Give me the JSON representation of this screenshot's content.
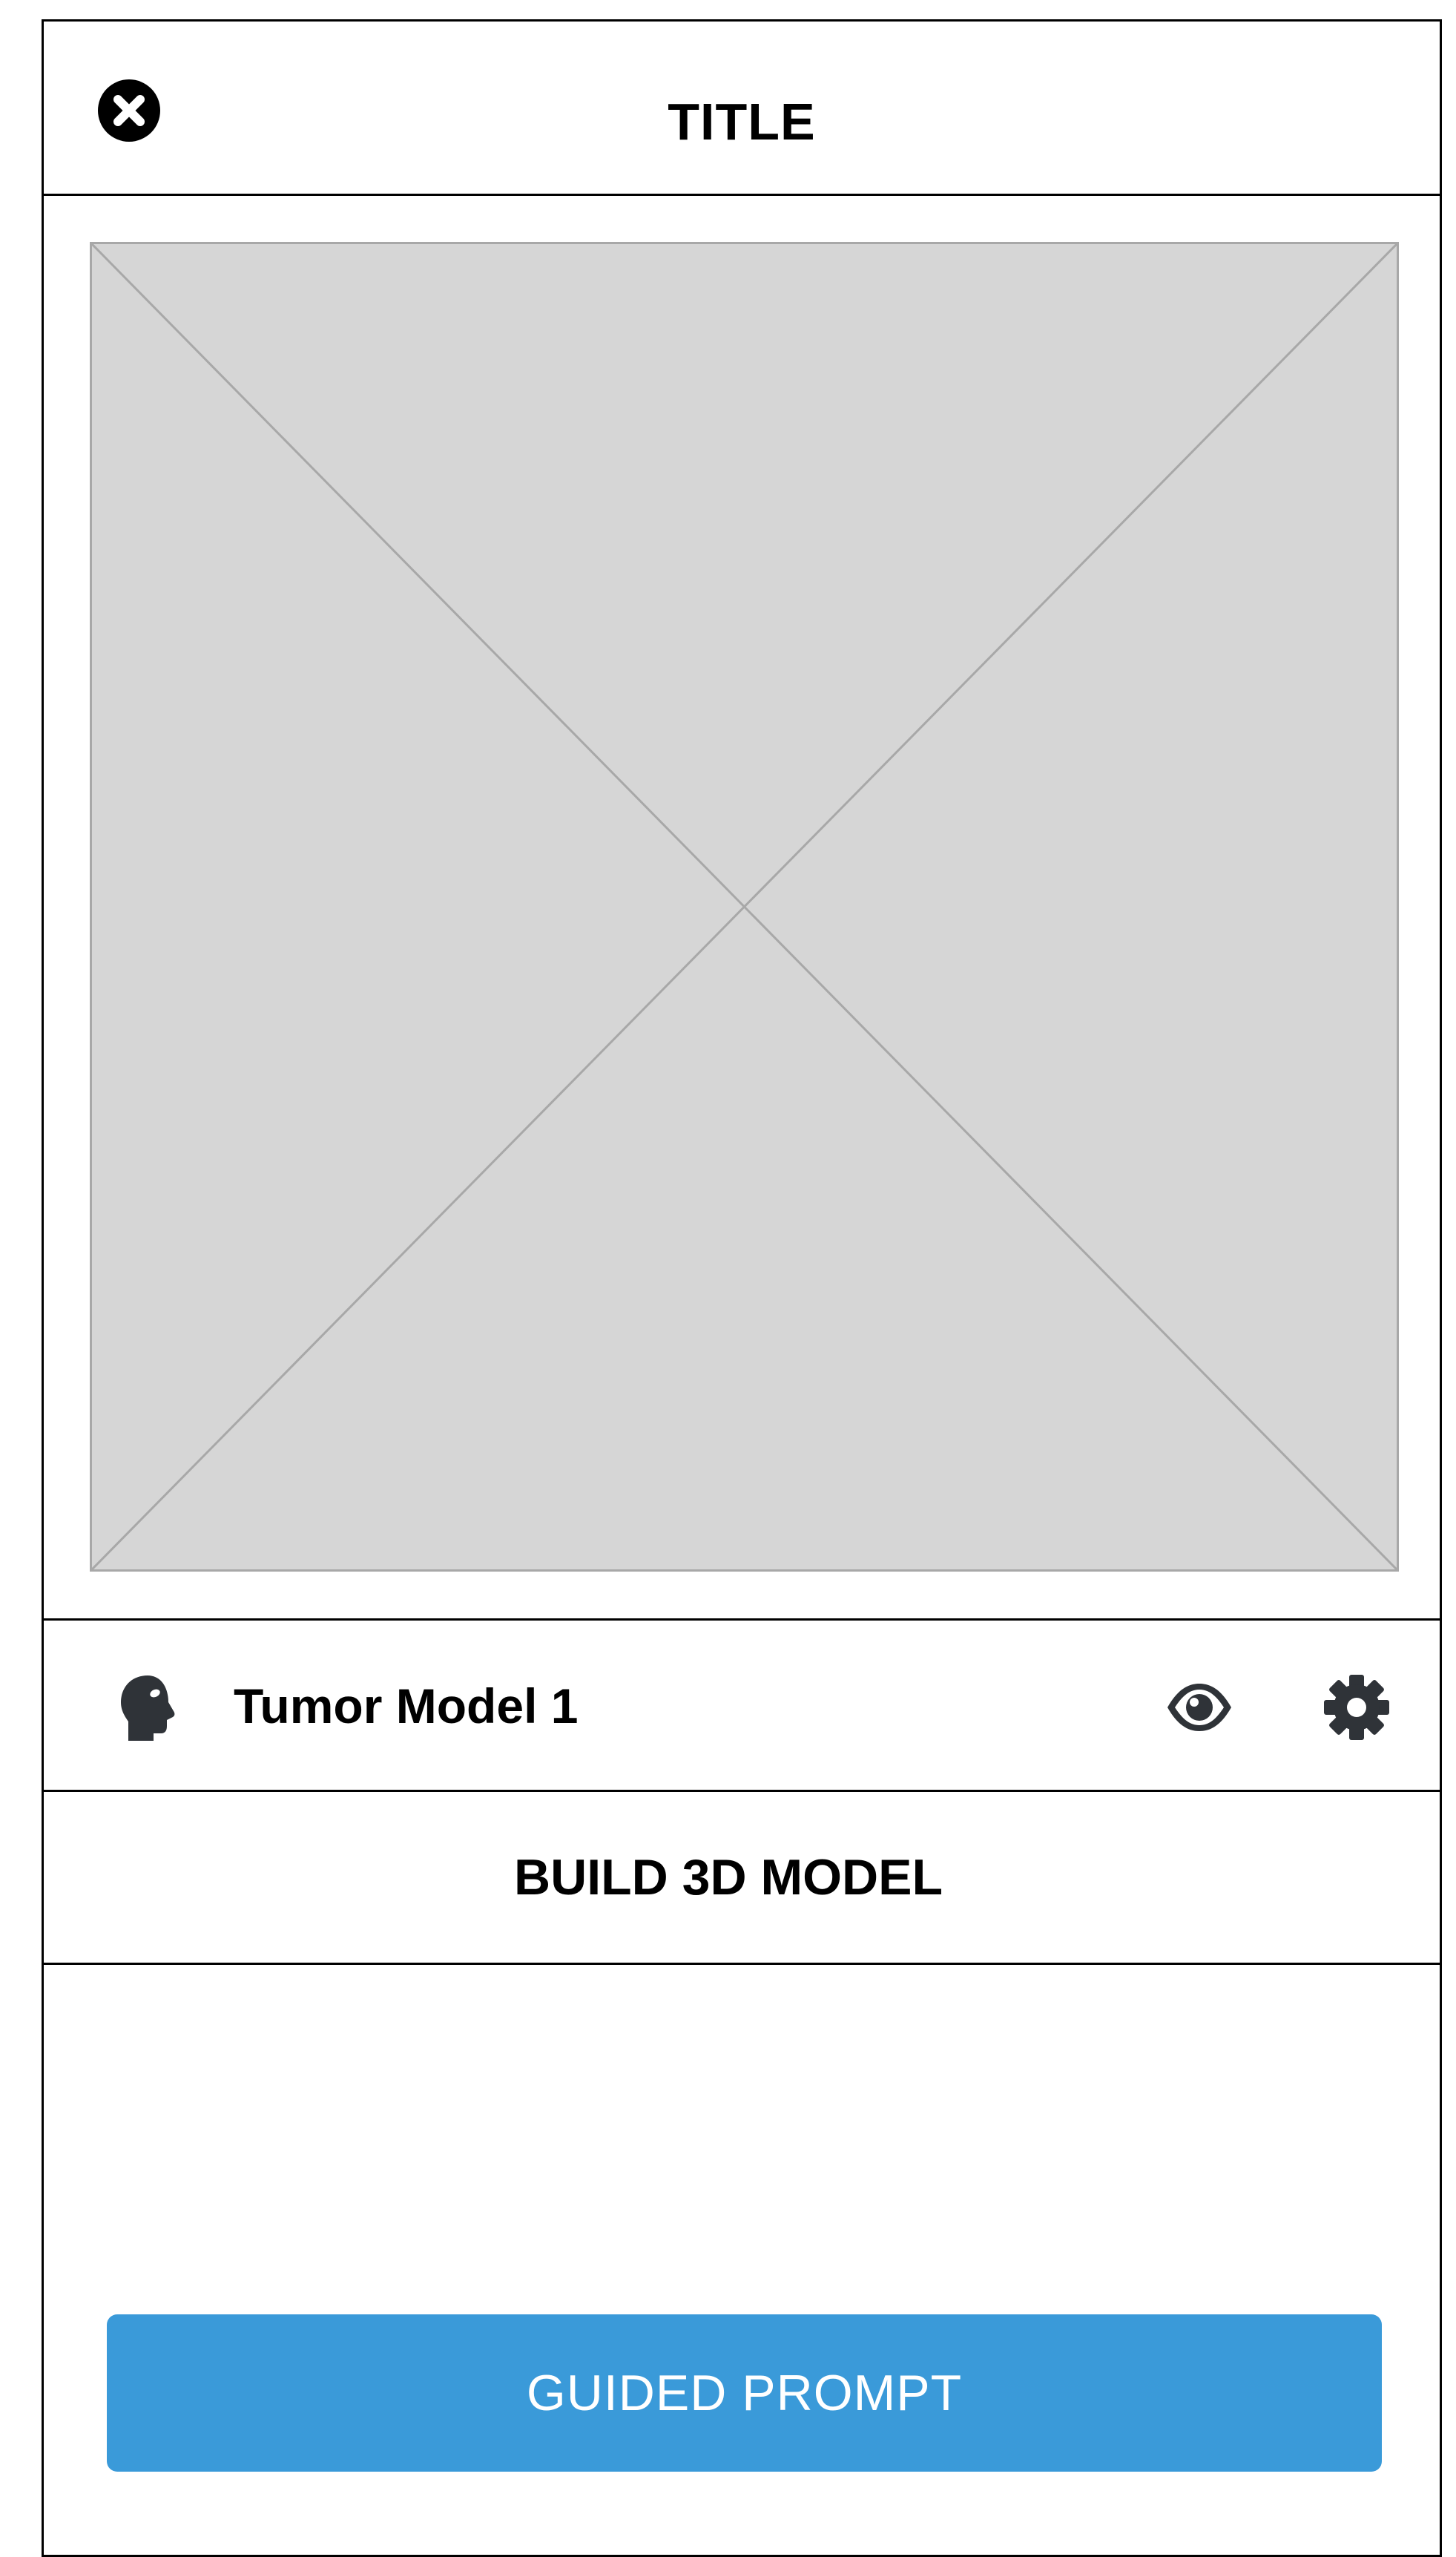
{
  "header": {
    "title": "TITLE",
    "close_icon": "close-circle-icon"
  },
  "media": {
    "placeholder_icon": "image-placeholder"
  },
  "model": {
    "name": "Tumor Model 1",
    "type_icon": "head-profile-icon",
    "view_icon": "eye-icon",
    "settings_icon": "gear-icon"
  },
  "actions": {
    "build_label": "BUILD 3D MODEL",
    "guided_prompt_label": "GUIDED PROMPT"
  },
  "colors": {
    "primary": "#3a9ad9",
    "placeholder_fill": "#d6d6d6",
    "placeholder_stroke": "#a8a8a8",
    "icon_dark": "#2f3338"
  }
}
